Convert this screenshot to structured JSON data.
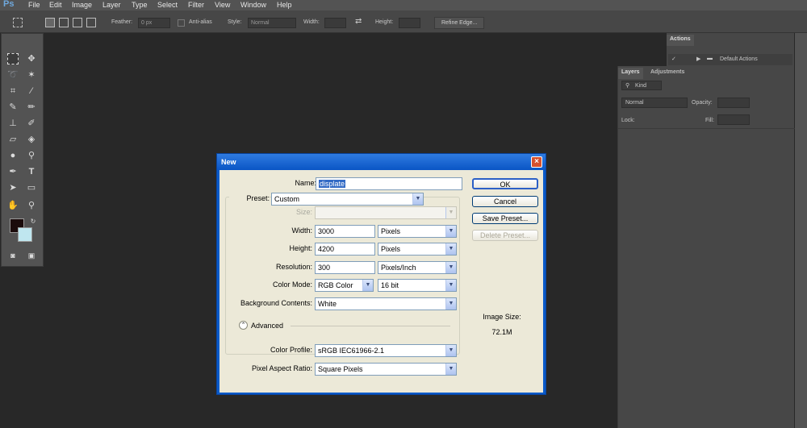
{
  "app": {
    "logo": "Ps"
  },
  "menu": [
    "File",
    "Edit",
    "Image",
    "Layer",
    "Type",
    "Select",
    "Filter",
    "View",
    "Window",
    "Help"
  ],
  "options_bar": {
    "feather_label": "Feather:",
    "feather_value": "0 px",
    "antialias_label": "Anti-alias",
    "style_label": "Style:",
    "style_value": "Normal",
    "width_label": "Width:",
    "height_label": "Height:",
    "refine_edge": "Refine Edge..."
  },
  "actions_panel": {
    "tab": "Actions",
    "item": "Default Actions"
  },
  "layers_panel": {
    "tabs": [
      "Layers",
      "Adjustments"
    ],
    "kind_label": "Kind",
    "blend_mode": "Normal",
    "opacity_label": "Opacity:",
    "lock_label": "Lock:",
    "fill_label": "Fill:"
  },
  "dialog": {
    "title": "New",
    "name_label": "Name:",
    "name_value": "displate",
    "preset_label": "Preset:",
    "preset_value": "Custom",
    "size_label": "Size:",
    "width_label": "Width:",
    "width_value": "3000",
    "width_unit": "Pixels",
    "height_label": "Height:",
    "height_value": "4200",
    "height_unit": "Pixels",
    "resolution_label": "Resolution:",
    "resolution_value": "300",
    "resolution_unit": "Pixels/Inch",
    "color_mode_label": "Color Mode:",
    "color_mode_value": "RGB Color",
    "bit_depth": "16 bit",
    "bg_label": "Background Contents:",
    "bg_value": "White",
    "advanced_label": "Advanced",
    "color_profile_label": "Color Profile:",
    "color_profile_value": "sRGB IEC61966-2.1",
    "pixel_aspect_label": "Pixel Aspect Ratio:",
    "pixel_aspect_value": "Square Pixels",
    "ok": "OK",
    "cancel": "Cancel",
    "save_preset": "Save Preset...",
    "delete_preset": "Delete Preset...",
    "image_size_label": "Image Size:",
    "image_size_value": "72.1M"
  },
  "colors": {
    "foreground": "#1a0b0b",
    "background": "#bfe6ef",
    "accent": "#0a5ac8"
  }
}
